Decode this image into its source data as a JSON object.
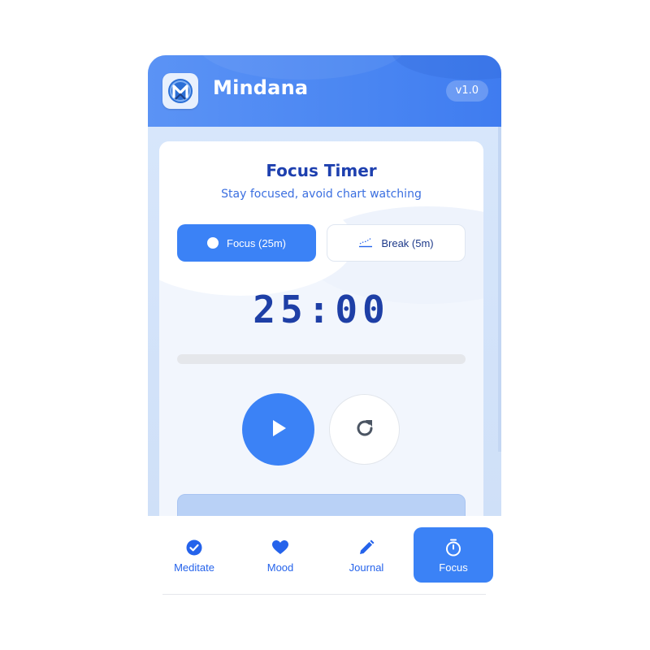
{
  "app": {
    "title": "Mindana",
    "version": "v1.0",
    "logo_icon": "mindana-logo-icon"
  },
  "timer_card": {
    "title": "Focus Timer",
    "subtitle": "Stay focused, avoid chart watching",
    "modes": [
      {
        "label": "Focus (25m)",
        "icon": "circle-icon",
        "active": true
      },
      {
        "label": "Break (5m)",
        "icon": "trend-chart-icon",
        "active": false
      }
    ],
    "time_display": "25:00",
    "progress": 0,
    "controls": {
      "play_icon": "play-icon",
      "reset_icon": "refresh-icon"
    }
  },
  "bottom_nav": {
    "items": [
      {
        "label": "Meditate",
        "icon": "check-circle-icon",
        "active": false
      },
      {
        "label": "Mood",
        "icon": "heart-icon",
        "active": false
      },
      {
        "label": "Journal",
        "icon": "pencil-icon",
        "active": false
      },
      {
        "label": "Focus",
        "icon": "stopwatch-icon",
        "active": true
      }
    ]
  },
  "colors": {
    "accent": "#3b82f6",
    "header": "#4a86f2",
    "title": "#1e40af"
  }
}
